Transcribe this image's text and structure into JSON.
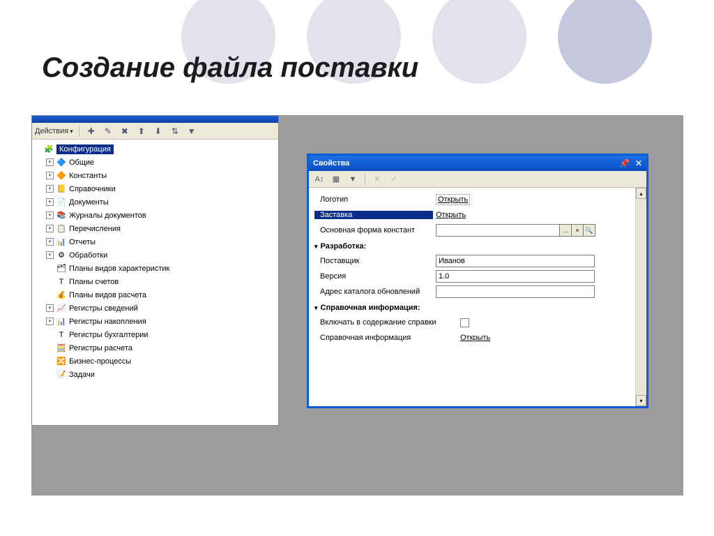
{
  "slide": {
    "title": "Создание файла поставки"
  },
  "left_panel": {
    "actions_label": "Действия",
    "root": "Конфигурация",
    "items": [
      {
        "label": "Общие",
        "expandable": true,
        "icon": "🔷"
      },
      {
        "label": "Константы",
        "expandable": true,
        "icon": "🔶"
      },
      {
        "label": "Справочники",
        "expandable": true,
        "icon": "📒"
      },
      {
        "label": "Документы",
        "expandable": true,
        "icon": "📄"
      },
      {
        "label": "Журналы документов",
        "expandable": true,
        "icon": "📚"
      },
      {
        "label": "Перечисления",
        "expandable": true,
        "icon": "📋"
      },
      {
        "label": "Отчеты",
        "expandable": true,
        "icon": "📊"
      },
      {
        "label": "Обработки",
        "expandable": true,
        "icon": "⚙"
      },
      {
        "label": "Планы видов характеристик",
        "expandable": false,
        "icon": "🗂"
      },
      {
        "label": "Планы счетов",
        "expandable": false,
        "icon": "Т"
      },
      {
        "label": "Планы видов расчета",
        "expandable": false,
        "icon": "💰"
      },
      {
        "label": "Регистры сведений",
        "expandable": true,
        "icon": "📈"
      },
      {
        "label": "Регистры накопления",
        "expandable": true,
        "icon": "📊"
      },
      {
        "label": "Регистры бухгалтерии",
        "expandable": false,
        "icon": "Т"
      },
      {
        "label": "Регистры расчета",
        "expandable": false,
        "icon": "🧮"
      },
      {
        "label": "Бизнес-процессы",
        "expandable": false,
        "icon": "🔀"
      },
      {
        "label": "Задачи",
        "expandable": false,
        "icon": "📝"
      }
    ]
  },
  "prop": {
    "title": "Свойства",
    "rows": {
      "logo_label": "Логотип",
      "logo_link": "Открыть",
      "splash_label": "Заставка",
      "splash_link": "Открыть",
      "constform_label": "Основная форма констант",
      "dev_section": "Разработка:",
      "supplier_label": "Поставщик",
      "supplier_value": "Иванов",
      "version_label": "Версия",
      "version_value": "1.0",
      "catalog_label": "Адрес каталога обновлений",
      "catalog_value": "",
      "help_section": "Справочная информация:",
      "include_help_label": "Включать в содержание справки",
      "help_info_label": "Справочная информация",
      "help_info_link": "Открыть"
    }
  }
}
